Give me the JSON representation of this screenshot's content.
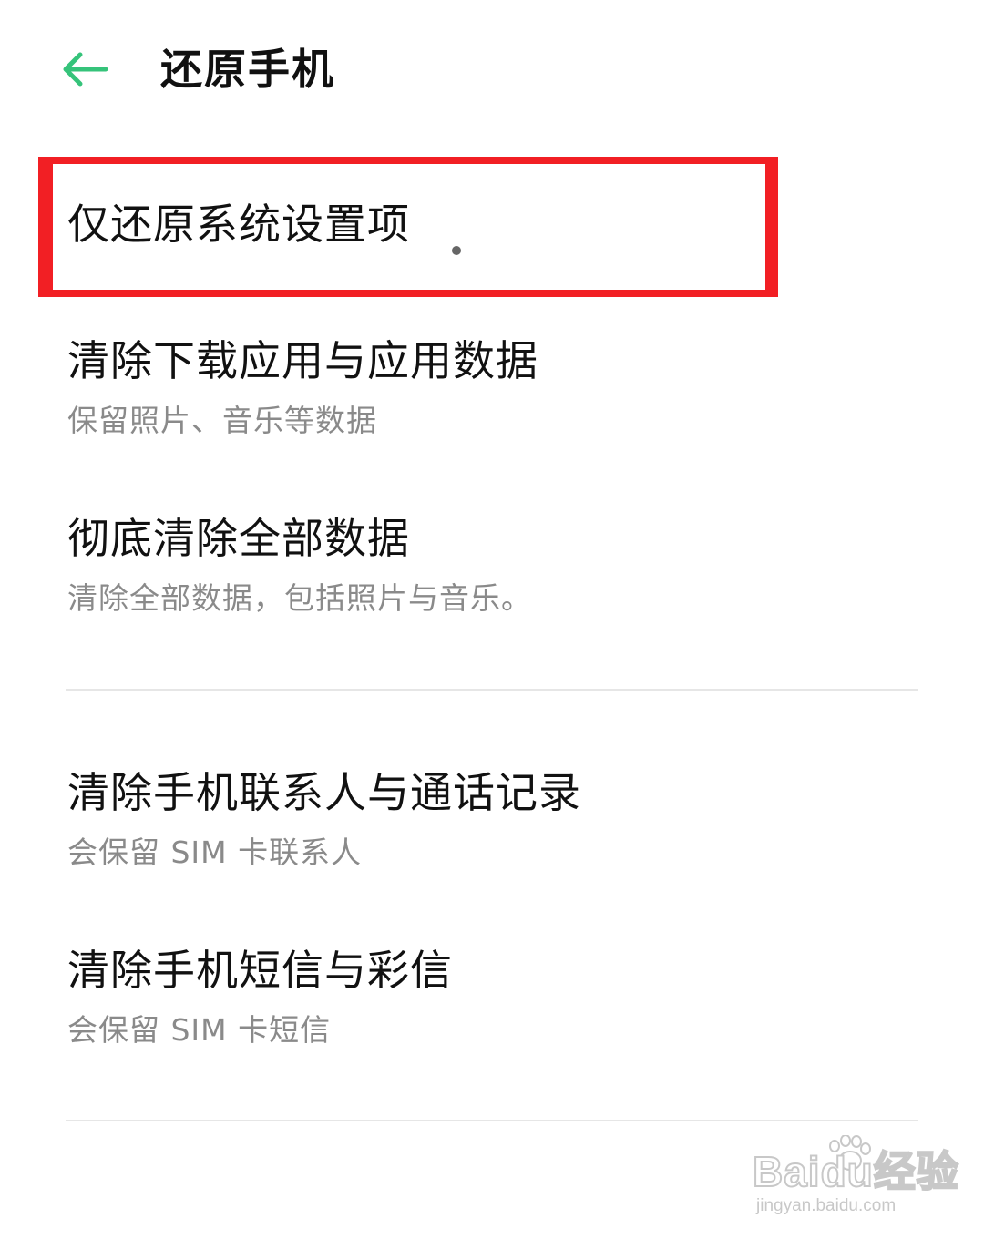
{
  "header": {
    "back_icon": "arrow-left-icon",
    "title": "还原手机",
    "accent_color": "#35c37a"
  },
  "options": [
    {
      "title": "仅还原系统设置项",
      "subtitle": ""
    },
    {
      "title": "清除下载应用与应用数据",
      "subtitle": "保留照片、音乐等数据"
    },
    {
      "title": "彻底清除全部数据",
      "subtitle": "清除全部数据，包括照片与音乐。"
    },
    {
      "title": "清除手机联系人与通话记录",
      "subtitle": "会保留 SIM 卡联系人"
    },
    {
      "title": "清除手机短信与彩信",
      "subtitle": "会保留 SIM 卡短信"
    }
  ],
  "highlight": {
    "color": "#f21f24"
  },
  "watermark": {
    "logo": "Baidu经验",
    "url": "jingyan.baidu.com"
  }
}
